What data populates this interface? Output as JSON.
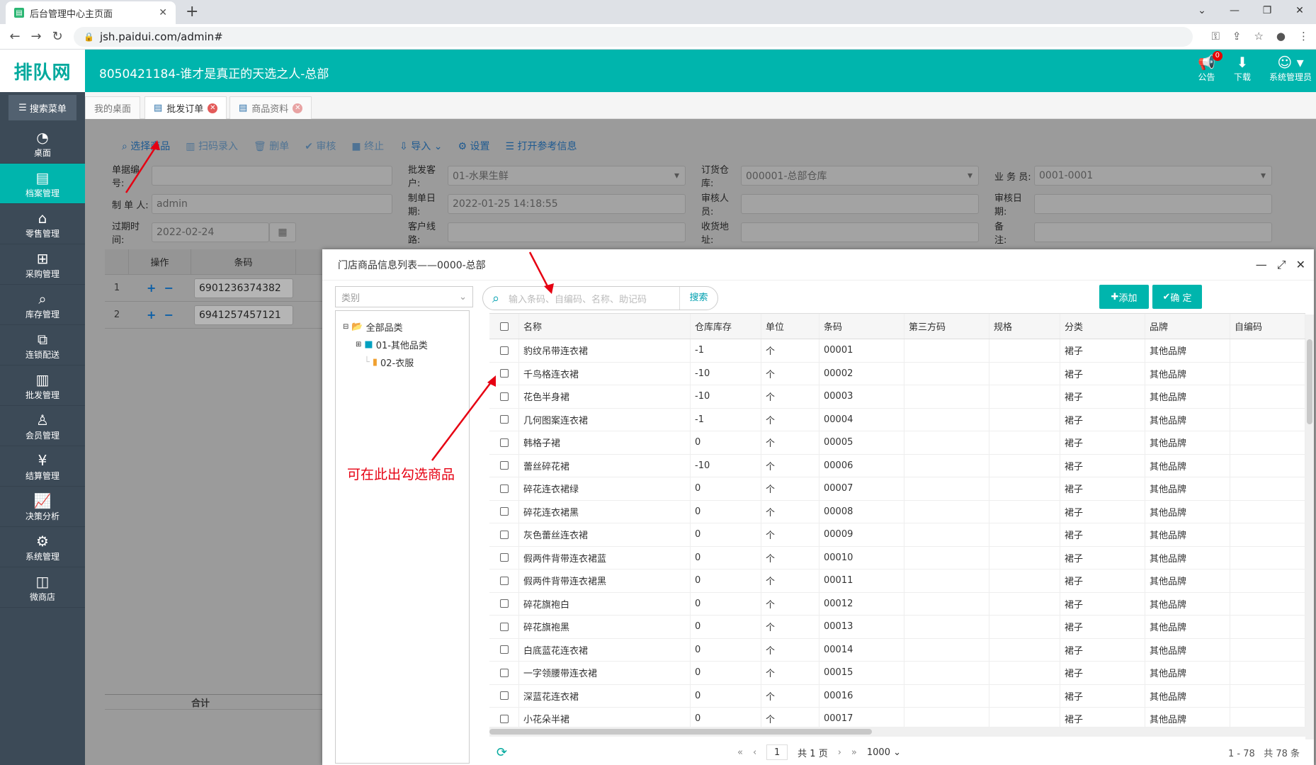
{
  "browser": {
    "tab_title": "后台管理中心主页面",
    "url": "jsh.paidui.com/admin#"
  },
  "app": {
    "logo": "排队网",
    "title": "8050421184-谁才是真正的天选之人-总部",
    "header_actions": [
      {
        "label": "公告",
        "badge": "0"
      },
      {
        "label": "下载"
      },
      {
        "label": "系统管理员"
      }
    ]
  },
  "sidebar": {
    "search_menu": "搜索菜单",
    "items": [
      {
        "label": "桌面"
      },
      {
        "label": "档案管理",
        "active": true
      },
      {
        "label": "零售管理"
      },
      {
        "label": "采购管理"
      },
      {
        "label": "库存管理"
      },
      {
        "label": "连锁配送"
      },
      {
        "label": "批发管理"
      },
      {
        "label": "会员管理"
      },
      {
        "label": "结算管理"
      },
      {
        "label": "决策分析"
      },
      {
        "label": "系统管理"
      },
      {
        "label": "微商店"
      }
    ]
  },
  "page_tabs": [
    {
      "label": "我的桌面"
    },
    {
      "label": "批发订单",
      "active": true
    },
    {
      "label": "商品资料"
    }
  ],
  "toolbar": [
    "选择商品",
    "扫码录入",
    "删单",
    "审核",
    "终止",
    "导入",
    "设置",
    "打开参考信息"
  ],
  "form": {
    "doc_no_label": "单据编号:",
    "doc_no": "",
    "customer_label": "批发客户:",
    "customer": "01-水果生鲜",
    "warehouse_label": "订货仓库:",
    "warehouse": "000001-总部仓库",
    "salesman_label": "业 务 员:",
    "salesman": "0001-0001",
    "maker_label": "制 单 人:",
    "maker": "admin",
    "make_date_label": "制单日期:",
    "make_date": "2022-01-25 14:18:55",
    "auditor_label": "审核人员:",
    "auditor": "",
    "audit_date_label": "审核日期:",
    "audit_date": "",
    "expire_label": "过期时间:",
    "expire": "2022-02-24",
    "route_label": "客户线路:",
    "route": "",
    "address_label": "收货地址:",
    "address": "",
    "remark_label": "备　　注:",
    "remark": ""
  },
  "order_grid": {
    "headers": [
      "操作",
      "条码"
    ],
    "rows": [
      {
        "no": "1",
        "barcode": "6901236374382"
      },
      {
        "no": "2",
        "barcode": "6941257457121"
      }
    ],
    "total_label": "合计"
  },
  "modal": {
    "title": "门店商品信息列表——0000-总部",
    "category_placeholder": "类别",
    "tree": [
      "全部品类",
      "01-其他品类",
      "02-衣服"
    ],
    "search_placeholder": "输入条码、自编码、名称、助记码",
    "search_btn": "搜索",
    "add_btn": "添加",
    "ok_btn": "确 定",
    "columns": [
      "名称",
      "仓库库存",
      "单位",
      "条码",
      "第三方码",
      "规格",
      "分类",
      "品牌",
      "自编码"
    ],
    "rows": [
      [
        "豹纹吊带连衣裙",
        "-1",
        "个",
        "00001",
        "",
        "",
        "裙子",
        "其他品牌",
        ""
      ],
      [
        "千鸟格连衣裙",
        "-10",
        "个",
        "00002",
        "",
        "",
        "裙子",
        "其他品牌",
        ""
      ],
      [
        "花色半身裙",
        "-10",
        "个",
        "00003",
        "",
        "",
        "裙子",
        "其他品牌",
        ""
      ],
      [
        "几何图案连衣裙",
        "-1",
        "个",
        "00004",
        "",
        "",
        "裙子",
        "其他品牌",
        ""
      ],
      [
        "韩格子裙",
        "0",
        "个",
        "00005",
        "",
        "",
        "裙子",
        "其他品牌",
        ""
      ],
      [
        "蕾丝碎花裙",
        "-10",
        "个",
        "00006",
        "",
        "",
        "裙子",
        "其他品牌",
        ""
      ],
      [
        "碎花连衣裙绿",
        "0",
        "个",
        "00007",
        "",
        "",
        "裙子",
        "其他品牌",
        ""
      ],
      [
        "碎花连衣裙黑",
        "0",
        "个",
        "00008",
        "",
        "",
        "裙子",
        "其他品牌",
        ""
      ],
      [
        "灰色蕾丝连衣裙",
        "0",
        "个",
        "00009",
        "",
        "",
        "裙子",
        "其他品牌",
        ""
      ],
      [
        "假两件背带连衣裙蓝",
        "0",
        "个",
        "00010",
        "",
        "",
        "裙子",
        "其他品牌",
        ""
      ],
      [
        "假两件背带连衣裙黑",
        "0",
        "个",
        "00011",
        "",
        "",
        "裙子",
        "其他品牌",
        ""
      ],
      [
        "碎花旗袍白",
        "0",
        "个",
        "00012",
        "",
        "",
        "裙子",
        "其他品牌",
        ""
      ],
      [
        "碎花旗袍黑",
        "0",
        "个",
        "00013",
        "",
        "",
        "裙子",
        "其他品牌",
        ""
      ],
      [
        "白底蓝花连衣裙",
        "0",
        "个",
        "00014",
        "",
        "",
        "裙子",
        "其他品牌",
        ""
      ],
      [
        "一字领腰带连衣裙",
        "0",
        "个",
        "00015",
        "",
        "",
        "裙子",
        "其他品牌",
        ""
      ],
      [
        "深蓝花连衣裙",
        "0",
        "个",
        "00016",
        "",
        "",
        "裙子",
        "其他品牌",
        ""
      ],
      [
        "小花朵半裙",
        "0",
        "个",
        "00017",
        "",
        "",
        "裙子",
        "其他品牌",
        ""
      ]
    ],
    "pager": {
      "page": "1",
      "total_pages": "共 1 页",
      "page_size": "1000",
      "range": "1 - 78",
      "total": "共 78 条"
    }
  },
  "annotation": "可在此出勾选商品"
}
